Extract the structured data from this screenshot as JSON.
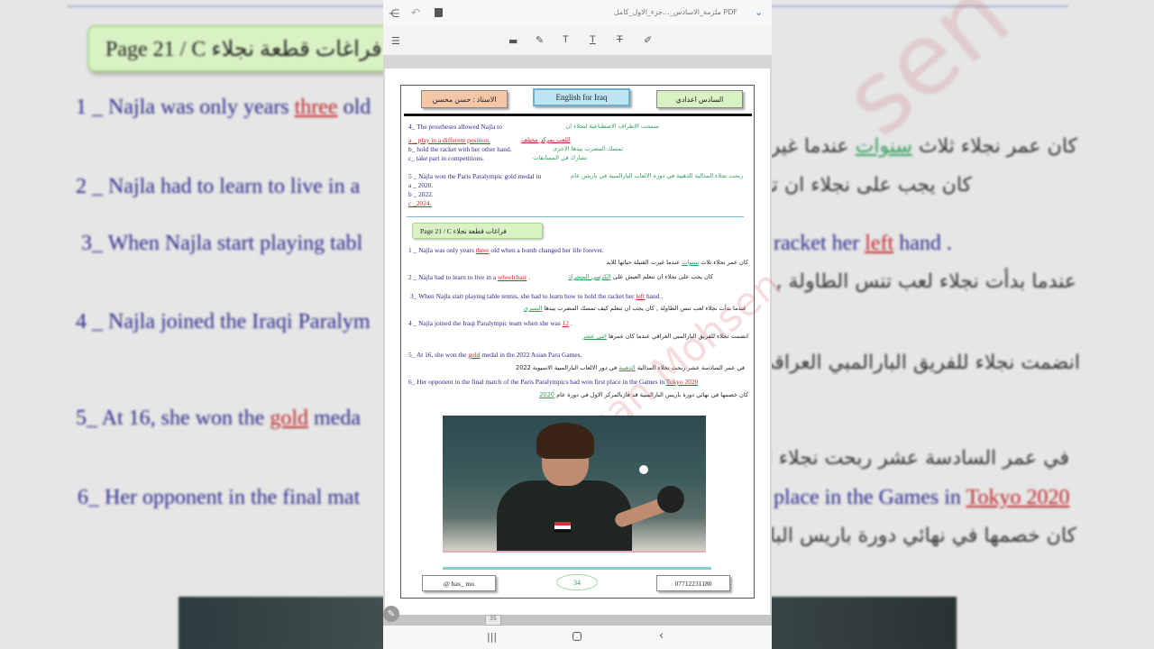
{
  "viewer": {
    "doc_title": "ملزمة_الاسادس_...جزء_الاول_كامل",
    "doc_type": "PDF",
    "topbar_icons": [
      "share-icon",
      "undo-icon",
      "save-icon",
      "chevron-down-icon"
    ],
    "toolbar_icons": [
      "menu-icon",
      "comment-icon",
      "pen-icon",
      "text-icon",
      "text-underline-icon",
      "text-strikethrough-icon",
      "highlighter-icon"
    ],
    "scroll_label": "35"
  },
  "page": {
    "header": {
      "teacher": "الاستاذ : حسن محسن",
      "subject": "English for Iraq",
      "grade": "السادس اعدادي"
    },
    "q4": {
      "en": "4_  The prostheses allowed Najla to",
      "ar": "سمحت الاطراف الاصطناعية لنجلاء  ان",
      "a_en": "a _ play in a different position.",
      "a_ar": "اللعب بمركز مختلف",
      "b_en": "b_  hold the racket with her other hand.",
      "b_ar": "تمسك المضرب بيدها الاخرى",
      "c_en": "c_  take part in competitions.",
      "c_ar": "تشارك في المسابقات"
    },
    "q5": {
      "en": "5 _ Najla won the Paris Paralympic gold medal in",
      "ar": "ربحت نجلاء المدالية الذهبية في دورة الالعاب البارالمبية في باريس عام",
      "a": "a _ 2020.",
      "b": "b _ 2022.",
      "c": "c _2024."
    },
    "section_banner": "Page 21 / C   فراغات  قطعة نجلاء",
    "gaps": {
      "g1_pre": "1 _ Najla was only years",
      "g1_ans": "three",
      "g1_post": "old when a bomb changed her life forever.",
      "g1_ar_pre": "كان عمر نجلاء ثلاث",
      "g1_ar_ans": "سنوات",
      "g1_ar_post": "عندما غيرت القنبلة حياتها للابد",
      "g2_pre": "2 _ Najla had to learn to live in a",
      "g2_ans": "wheelchair",
      "g2_post": ".",
      "g2_ar_pre": "كان يجب على نجلاء ان تتعلم العيش على",
      "g2_ar_ans": "الكرسي المتحرك",
      "g3_pre": "3_  When Najla start playing table tennis, she had to learn how to hold the racket  her",
      "g3_ans": "left",
      "g3_post": "hand .",
      "g3_ar_pre": "عندما بدأت نجلاء لعب تنس الطاولة , كان يجب ان تتعلم كيف تمسك المضرب بيدها",
      "g3_ar_ans": "اليسرى",
      "g4_pre": "4 _ Najla joined the Iraqi Paralympic team when she was",
      "g4_ans": "12",
      "g4_post": ".",
      "g4_ar_pre": "انضمت نجلاء للفريق البارالمبي العراقي عندما كان عمرها",
      "g4_ar_ans": "اثنى عشر",
      "g5_pre": "5_ At 16, she won the",
      "g5_ans": "gold",
      "g5_post": "medal in the 2022 Asian Para Games.",
      "g5_ar_pre": "في عمر السادسة عشر ربحت نجلاء المدالية",
      "g5_ar_ans": "الذهبية",
      "g5_ar_post": "في دور الالعاب البارالمبية  الاسيوية 2022",
      "g6_pre": "6_  Her opponent in the final match of the Paris Paralympics had won first place in the Games in",
      "g6_ans": "Tokyo 2020",
      "g6_ar_pre": "كان خصمها في نهائي دورة باريس البارالمبية قد فازبالمركز الاول في دورة عام",
      "g6_ar_ans": "2020"
    },
    "footer": {
      "handle": "@ has_ mu",
      "page_number": "34",
      "phone": "07712231180"
    },
    "watermark": "Hassan Mohsen"
  },
  "background": {
    "banner": "Page 21 / C   فراغات  قطعة نجلاء",
    "l1_pre": "1 _ Najla was only years",
    "l1_ans": "three",
    "l1_post": "old",
    "l2": "2 _ Najla had to learn to live in a",
    "l3": "3_  When Najla start playing tabl",
    "l3_right_pre": "racket  her",
    "l3_right_ans": "left",
    "l3_right_post": "hand .",
    "l4": "4 _ Najla joined the Iraqi Paralym",
    "l5_pre": "5_ At 16, she won the",
    "l5_ans": "gold",
    "l5_post": "meda",
    "l6_pre": "6_  Her opponent in the final mat",
    "l6_right_pre": "place in the Games in",
    "l6_right_ans": "Tokyo 2020",
    "ar1_pre": "كان عمر نجلاء ثلاث",
    "ar1_ans": "سنوات",
    "ar1_post": "عندما غيرت",
    "ar2": "كان يجب على نجلاء ان تتعلم",
    "ar3": "عندما بدأت نجلاء لعب تنس الطاولة , كان",
    "ar4": "انضمت نجلاء للفريق البارالمبي العراقي عن",
    "ar5": "في عمر السادسة عشر ربحت نجلاء المدال",
    "ar6": "كان خصمها في نهائي دورة باريس البارال"
  }
}
